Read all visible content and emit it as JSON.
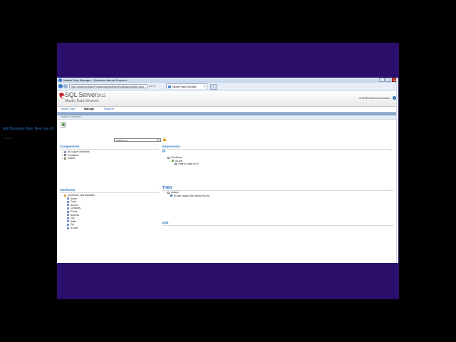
{
  "window": {
    "title": "Master Data Manager - Windows Internet Explorer",
    "controls": [
      "–",
      "□",
      "x"
    ]
  },
  "browser": {
    "url": "http://localhost:8080/Portal/BusinessRules/EditBusinessRule.aspx",
    "tab_title": "Master Data Manager",
    "tab_close": "x"
  },
  "header": {
    "product": "SQL Server",
    "year": "2012",
    "subtitle": "Master Data Services",
    "user": "SHAREDENV\\administrator",
    "help": "?"
  },
  "menu": {
    "items": [
      {
        "label": "Model View",
        "active": false
      },
      {
        "label": "Manage",
        "active": true
      },
      {
        "label": "Explorer",
        "active": false
      }
    ]
  },
  "breadcrumb": "Home / Customers",
  "page": {
    "title": "Edit Business Rule: New rule (1)",
    "version_label": "Version:",
    "version_value": "VERSION_1"
  },
  "components": {
    "header": "Components",
    "items": [
      {
        "label": "All Logical Operators"
      },
      {
        "label": "Conditions"
      },
      {
        "label": "Actions"
      }
    ]
  },
  "expression": {
    "header": "Expression:",
    "if_label": "IF",
    "if_items": [
      {
        "label": "Conditions",
        "level": 0
      },
      {
        "label": "All And",
        "level": 1
      },
      {
        "label": "State is equal to NJ",
        "level": 2
      }
    ],
    "then_label": "THEN",
    "then_items": [
      {
        "label": "Actions",
        "level": 0
      },
      {
        "label": "SCode equals Has Jersey Record",
        "level": 1
      }
    ],
    "edit_label": "Edit"
  },
  "attributes": {
    "header": "Attributes",
    "root": "Customers Leaf Attributes",
    "items": [
      "Name",
      "Code",
      "Source",
      "Company",
      "Phone",
      "Address",
      "City",
      "State",
      "Zip",
      "SCode"
    ]
  },
  "colors": {
    "desktop": "#2b0f6b",
    "accent": "#2a73c2"
  }
}
